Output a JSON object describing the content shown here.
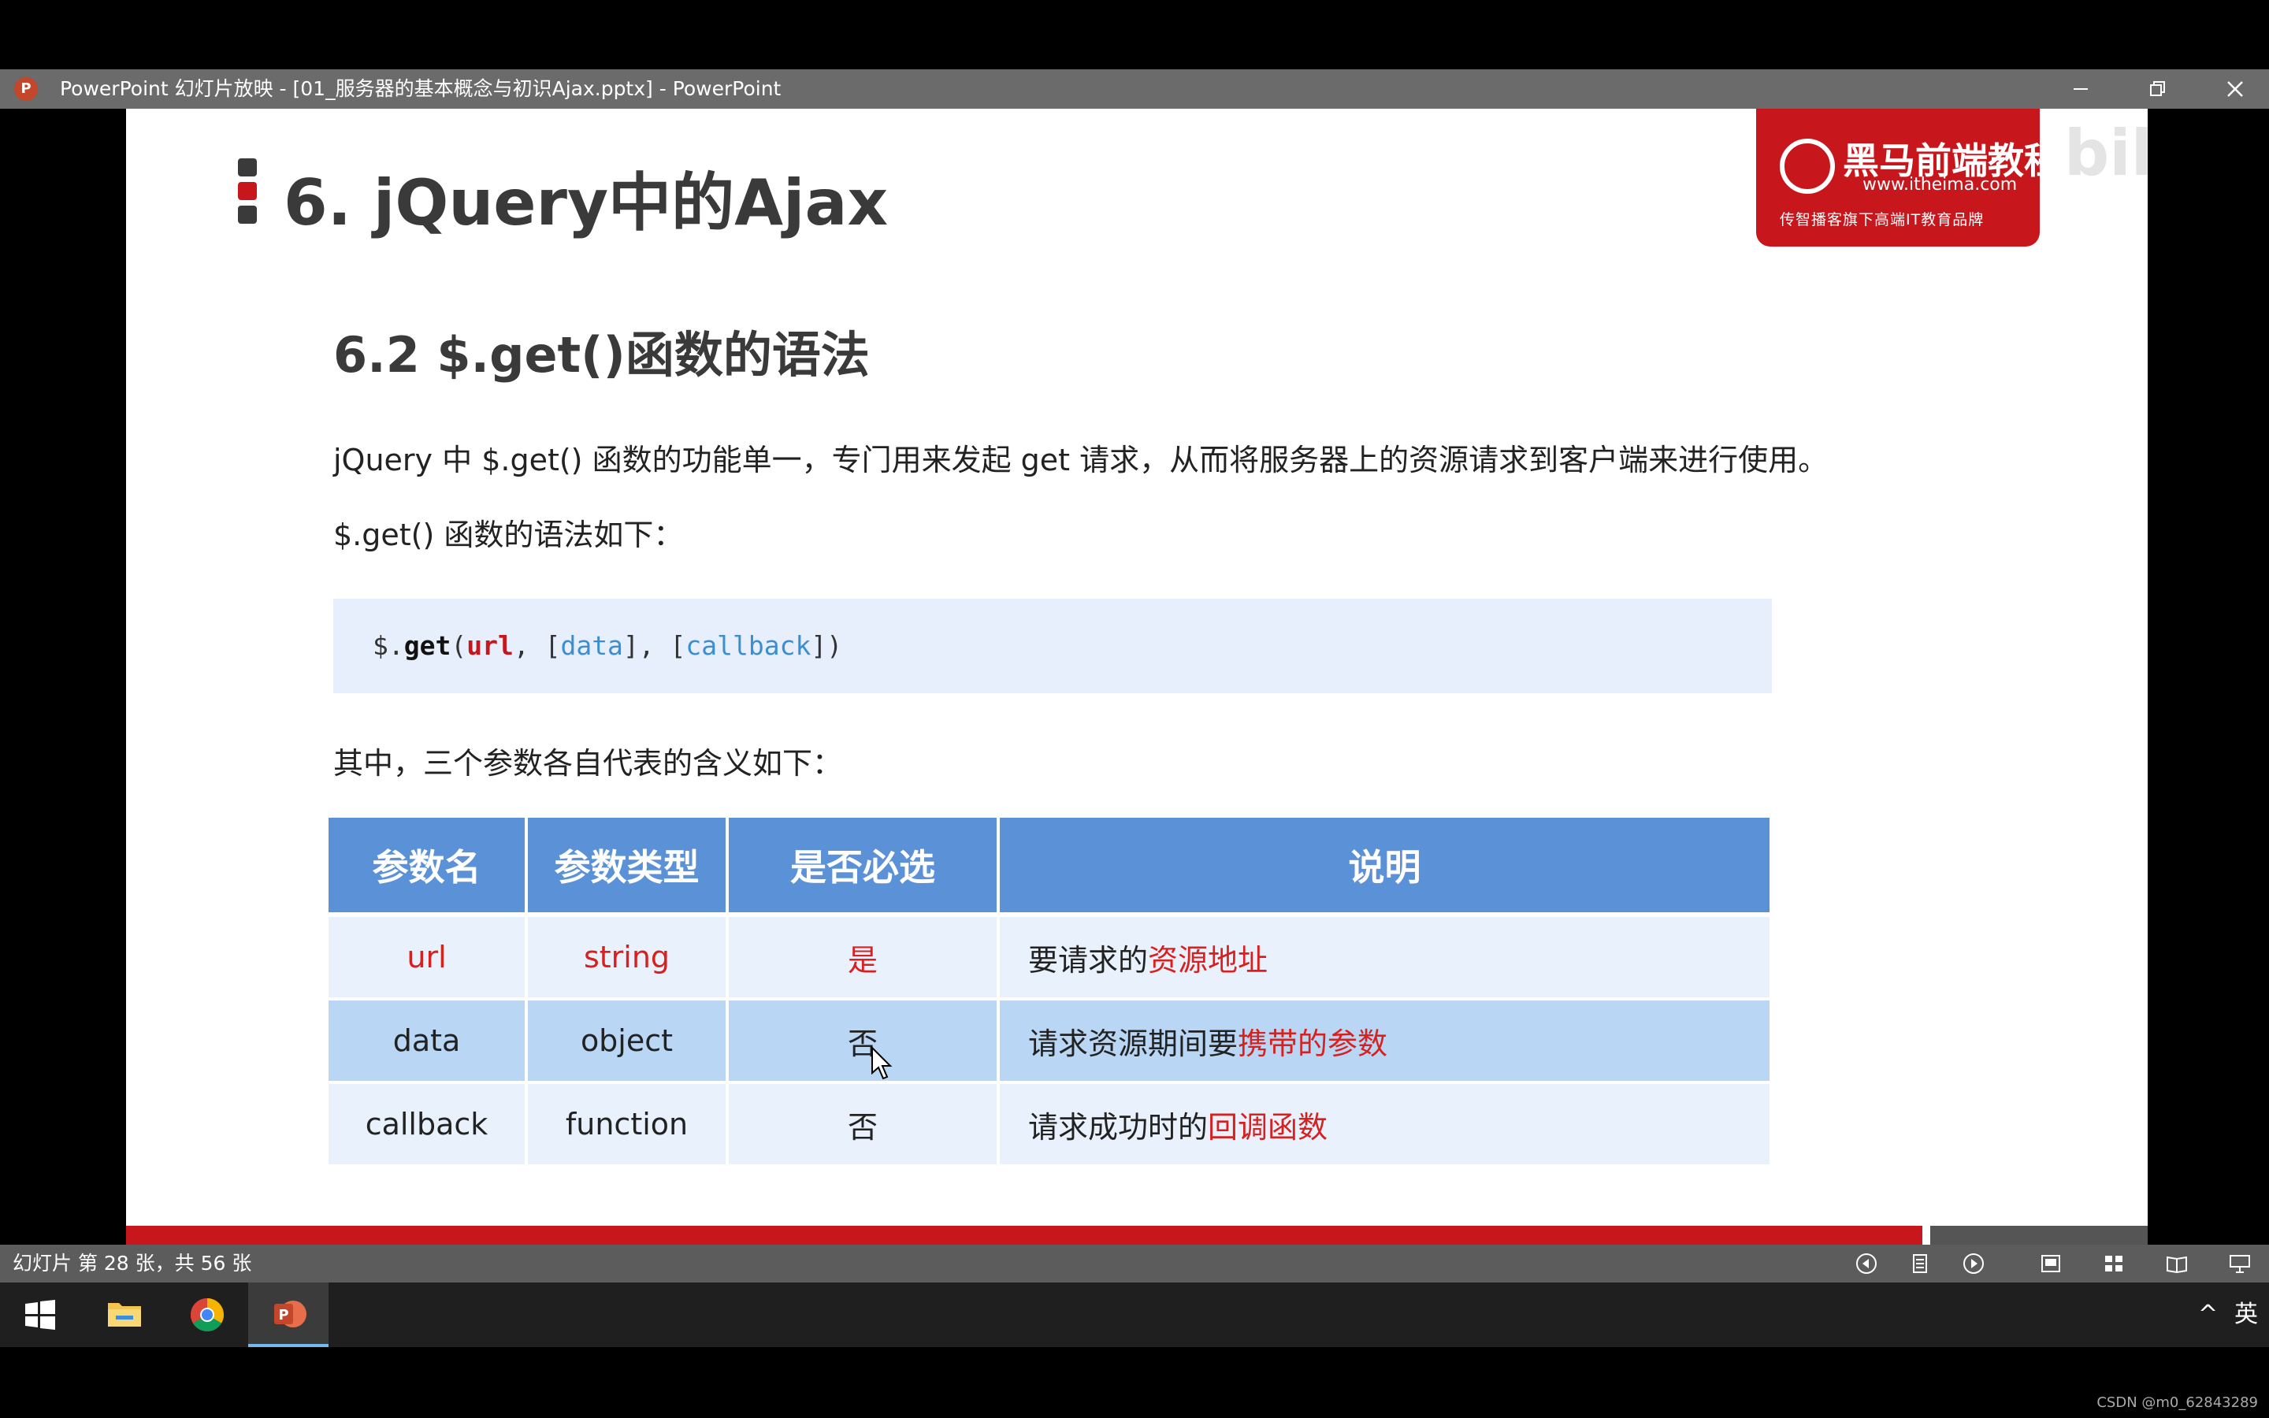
{
  "window": {
    "app_icon_letter": "P",
    "title": "PowerPoint 幻灯片放映 - [01_服务器的基本概念与初识Ajax.pptx] - PowerPoint"
  },
  "slide": {
    "title": "6. jQuery中的Ajax",
    "logo": {
      "brand": "黑马前端教程",
      "url": "www.itheima.com",
      "slogan": "传智播客旗下高端IT教育品牌"
    },
    "watermark": "bilibili",
    "subtitle": "6.2 $.get()函数的语法",
    "intro": "jQuery 中 $.get() 函数的功能单一，专门用来发起 get 请求，从而将服务器上的资源请求到客户端来进行使用。",
    "syntax_intro": "$.get() 函数的语法如下：",
    "code": {
      "prefix": "$.",
      "func": "get",
      "open": "(",
      "arg1": "url",
      "sep1": ", [",
      "arg2": "data",
      "sep2": "], [",
      "arg3": "callback",
      "close": "])"
    },
    "params_intro": "其中，三个参数各自代表的含义如下：",
    "table": {
      "headers": [
        "参数名",
        "参数类型",
        "是否必选",
        "说明"
      ],
      "rows": [
        {
          "name": "url",
          "type": "string",
          "required": "是",
          "desc_prefix": "要请求的",
          "desc_highlight": "资源地址"
        },
        {
          "name": "data",
          "type": "object",
          "required": "否",
          "desc_prefix": "请求资源期间要",
          "desc_highlight": "携带的参数"
        },
        {
          "name": "callback",
          "type": "function",
          "required": "否",
          "desc_prefix": "请求成功时的",
          "desc_highlight": "回调函数"
        }
      ]
    }
  },
  "statusbar": {
    "slide_info": "幻灯片 第 28 张，共 56 张"
  },
  "taskbar": {
    "ime": "英",
    "tray_chevron": "^"
  },
  "watermark_credit": "CSDN @m0_62843289",
  "colors": {
    "accent_red": "#c8161d",
    "table_header": "#5b92d7",
    "table_row_light": "#e9f2fc",
    "table_row_dark": "#b9d7f5",
    "code_bg": "#e7eefc",
    "code_optional": "#3b8fd0"
  }
}
